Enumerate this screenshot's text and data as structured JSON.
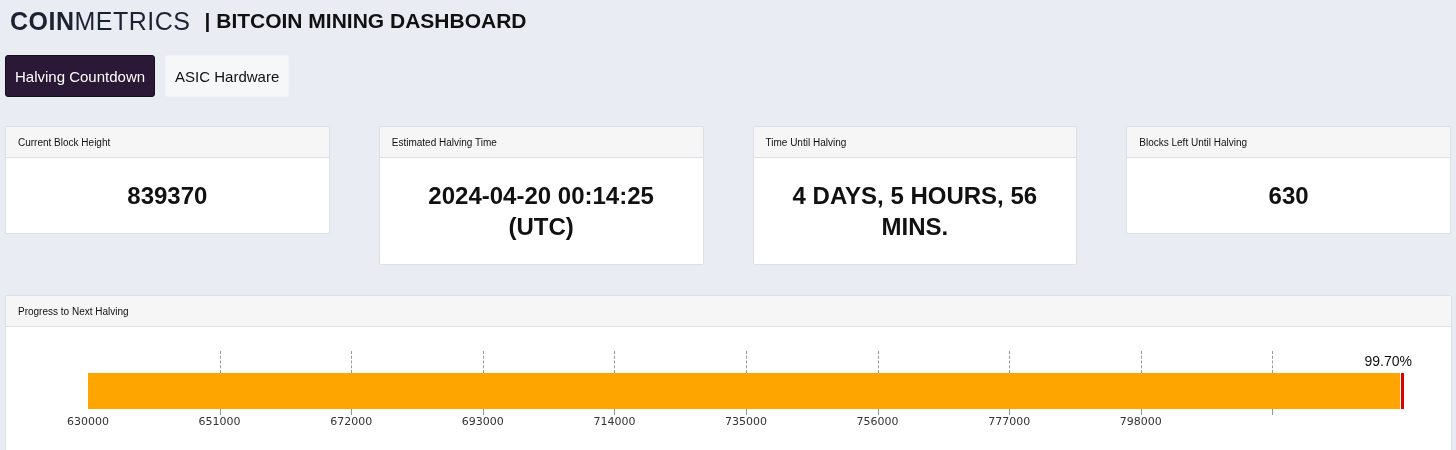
{
  "header": {
    "logo": "**COIN**METRICS",
    "title": "| BITCOIN MINING DASHBOARD"
  },
  "tabs": [
    {
      "label": "Halving Countdown",
      "selected": true
    },
    {
      "label": "ASIC Hardware",
      "selected": false
    }
  ],
  "cards": [
    {
      "title": "Current Block Height",
      "value": "839370"
    },
    {
      "title": "Estimated Halving Time",
      "value": "2024-04-20 00:14:25 (UTC)"
    },
    {
      "title": "Time Until Halving",
      "value": "4 DAYS, 5 HOURS, 56 MINS."
    },
    {
      "title": "Blocks Left Until Halving",
      "value": "630"
    }
  ],
  "progress": {
    "title": "Progress to Next Halving",
    "level": 0.997,
    "reading": "99.70%",
    "ticks": [
      "630000",
      "651000",
      "672000",
      "693000",
      "714000",
      "735000",
      "756000",
      "777000",
      "798000"
    ]
  }
}
